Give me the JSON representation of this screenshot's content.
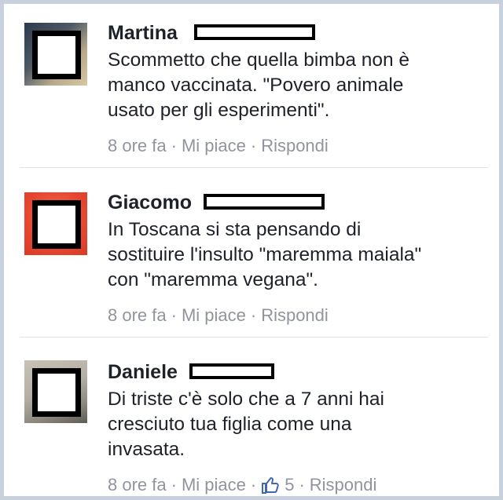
{
  "comments": [
    {
      "author": "Martina",
      "text": "Scommetto che quella bimba non è\nmanco vaccinata. \"Povero animale\nusato per gli esperimenti\".",
      "time": "8 ore fa",
      "like_label": "Mi piace",
      "reply_label": "Rispondi"
    },
    {
      "author": "Giacomo",
      "text": "In Toscana si sta pensando di\nsostituire l'insulto \"maremma maiala\"\ncon \"maremma vegana\".",
      "time": "8 ore fa",
      "like_label": "Mi piace",
      "reply_label": "Rispondi"
    },
    {
      "author": "Daniele",
      "text": "Di triste c'è solo che a 7 anni hai\ncresciuto tua figlia come una\ninvasata.",
      "time": "8 ore fa",
      "like_label": "Mi piace",
      "like_count": "5",
      "reply_label": "Rispondi"
    }
  ],
  "separator": "·",
  "colors": {
    "text": "#1d2129",
    "meta": "#90949c",
    "like_icon": "#4267b2",
    "frame": "#c7d0dc"
  }
}
